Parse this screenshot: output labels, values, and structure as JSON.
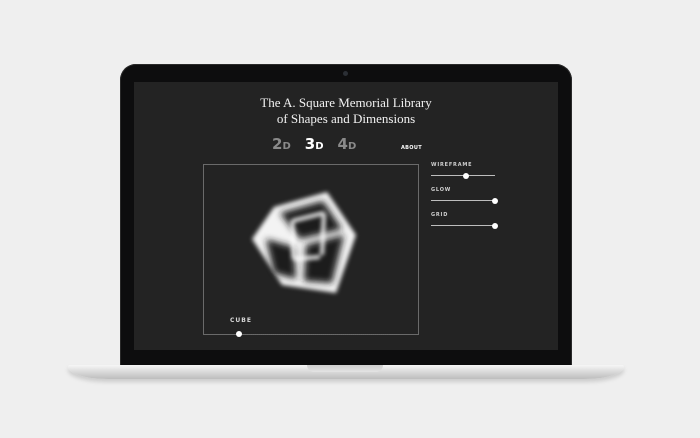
{
  "page": {
    "title_line1": "The A. Square Memorial Library",
    "title_line2": "of Shapes and Dimensions"
  },
  "dimensions": [
    {
      "num": "2",
      "sub": "D",
      "active": false
    },
    {
      "num": "3",
      "sub": "D",
      "active": true
    },
    {
      "num": "4",
      "sub": "D",
      "active": false
    }
  ],
  "nav": {
    "about_label": "ABOUT"
  },
  "viewer": {
    "shape_label": "CUBE",
    "shape_position": 0.0
  },
  "controls": [
    {
      "label": "WIREFRAME",
      "value": 0.55
    },
    {
      "label": "GLOW",
      "value": 1.0
    },
    {
      "label": "GRID",
      "value": 1.0
    }
  ],
  "colors": {
    "screen_bg": "#232323",
    "text": "#f2f2f2",
    "inactive_tab": "#8a8a8a",
    "accent": "#ffffff"
  }
}
